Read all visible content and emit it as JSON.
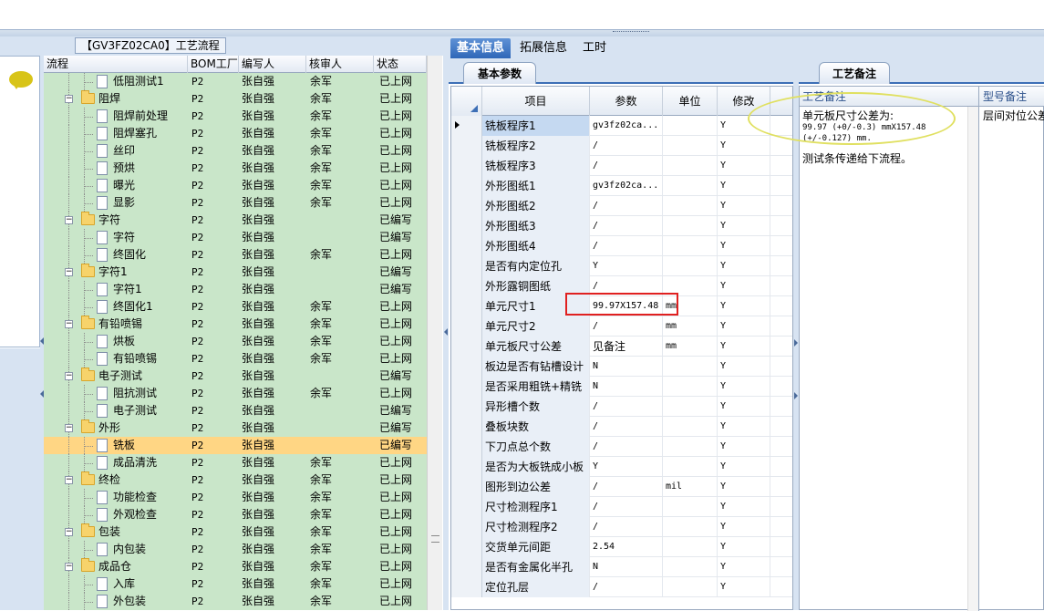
{
  "tree_caption": "【GV3FZ02CA0】工艺流程",
  "tree_columns": [
    "流程",
    "BOM工厂",
    "编写人",
    "核审人",
    "状态"
  ],
  "tree_rows": [
    {
      "name": "低阻测试1",
      "level": 2,
      "icon": "doc-icon",
      "bom": "P2",
      "writer": "张自强",
      "reviewer": "余军",
      "status": "已上网"
    },
    {
      "name": "阻焊",
      "level": 1,
      "icon": "folder-icon",
      "bom": "P2",
      "writer": "张自强",
      "reviewer": "余军",
      "status": "已上网"
    },
    {
      "name": "阻焊前处理",
      "level": 2,
      "icon": "doc-icon",
      "bom": "P2",
      "writer": "张自强",
      "reviewer": "余军",
      "status": "已上网"
    },
    {
      "name": "阻焊塞孔",
      "level": 2,
      "icon": "doc-icon",
      "bom": "P2",
      "writer": "张自强",
      "reviewer": "余军",
      "status": "已上网"
    },
    {
      "name": "丝印",
      "level": 2,
      "icon": "doc-icon",
      "bom": "P2",
      "writer": "张自强",
      "reviewer": "余军",
      "status": "已上网"
    },
    {
      "name": "预烘",
      "level": 2,
      "icon": "doc-icon",
      "bom": "P2",
      "writer": "张自强",
      "reviewer": "余军",
      "status": "已上网"
    },
    {
      "name": "曝光",
      "level": 2,
      "icon": "doc-icon",
      "bom": "P2",
      "writer": "张自强",
      "reviewer": "余军",
      "status": "已上网"
    },
    {
      "name": "显影",
      "level": 2,
      "icon": "doc-icon",
      "bom": "P2",
      "writer": "张自强",
      "reviewer": "余军",
      "status": "已上网"
    },
    {
      "name": "字符",
      "level": 1,
      "icon": "folder-icon",
      "bom": "P2",
      "writer": "张自强",
      "reviewer": "",
      "status": "已编写"
    },
    {
      "name": "字符",
      "level": 2,
      "icon": "doc-icon",
      "bom": "P2",
      "writer": "张自强",
      "reviewer": "",
      "status": "已编写"
    },
    {
      "name": "终固化",
      "level": 2,
      "icon": "doc-icon",
      "bom": "P2",
      "writer": "张自强",
      "reviewer": "余军",
      "status": "已上网"
    },
    {
      "name": "字符1",
      "level": 1,
      "icon": "folder-icon",
      "bom": "P2",
      "writer": "张自强",
      "reviewer": "",
      "status": "已编写"
    },
    {
      "name": "字符1",
      "level": 2,
      "icon": "doc-icon",
      "bom": "P2",
      "writer": "张自强",
      "reviewer": "",
      "status": "已编写"
    },
    {
      "name": "终固化1",
      "level": 2,
      "icon": "doc-icon",
      "bom": "P2",
      "writer": "张自强",
      "reviewer": "余军",
      "status": "已上网"
    },
    {
      "name": "有铅喷锡",
      "level": 1,
      "icon": "folder-icon",
      "bom": "P2",
      "writer": "张自强",
      "reviewer": "余军",
      "status": "已上网"
    },
    {
      "name": "烘板",
      "level": 2,
      "icon": "doc-icon",
      "bom": "P2",
      "writer": "张自强",
      "reviewer": "余军",
      "status": "已上网"
    },
    {
      "name": "有铅喷锡",
      "level": 2,
      "icon": "doc-icon",
      "bom": "P2",
      "writer": "张自强",
      "reviewer": "余军",
      "status": "已上网"
    },
    {
      "name": "电子测试",
      "level": 1,
      "icon": "folder-icon",
      "bom": "P2",
      "writer": "张自强",
      "reviewer": "",
      "status": "已编写"
    },
    {
      "name": "阻抗测试",
      "level": 2,
      "icon": "doc-icon",
      "bom": "P2",
      "writer": "张自强",
      "reviewer": "余军",
      "status": "已上网"
    },
    {
      "name": "电子测试",
      "level": 2,
      "icon": "doc-icon",
      "bom": "P2",
      "writer": "张自强",
      "reviewer": "",
      "status": "已编写"
    },
    {
      "name": "外形",
      "level": 1,
      "icon": "folder-icon",
      "bom": "P2",
      "writer": "张自强",
      "reviewer": "",
      "status": "已编写"
    },
    {
      "name": "铣板",
      "level": 2,
      "icon": "doc-icon",
      "bom": "P2",
      "writer": "张自强",
      "reviewer": "",
      "status": "已编写",
      "selected": true
    },
    {
      "name": "成品清洗",
      "level": 2,
      "icon": "doc-icon",
      "bom": "P2",
      "writer": "张自强",
      "reviewer": "余军",
      "status": "已上网"
    },
    {
      "name": "终检",
      "level": 1,
      "icon": "folder-icon",
      "bom": "P2",
      "writer": "张自强",
      "reviewer": "余军",
      "status": "已上网"
    },
    {
      "name": "功能检查",
      "level": 2,
      "icon": "doc-icon",
      "bom": "P2",
      "writer": "张自强",
      "reviewer": "余军",
      "status": "已上网"
    },
    {
      "name": "外观检查",
      "level": 2,
      "icon": "doc-icon",
      "bom": "P2",
      "writer": "张自强",
      "reviewer": "余军",
      "status": "已上网"
    },
    {
      "name": "包装",
      "level": 1,
      "icon": "folder-icon",
      "bom": "P2",
      "writer": "张自强",
      "reviewer": "余军",
      "status": "已上网"
    },
    {
      "name": "内包装",
      "level": 2,
      "icon": "doc-icon",
      "bom": "P2",
      "writer": "张自强",
      "reviewer": "余军",
      "status": "已上网"
    },
    {
      "name": "成品仓",
      "level": 1,
      "icon": "folder-icon",
      "bom": "P2",
      "writer": "张自强",
      "reviewer": "余军",
      "status": "已上网"
    },
    {
      "name": "入库",
      "level": 2,
      "icon": "doc-icon",
      "bom": "P2",
      "writer": "张自强",
      "reviewer": "余军",
      "status": "已上网"
    },
    {
      "name": "外包装",
      "level": 2,
      "icon": "doc-icon",
      "bom": "P2",
      "writer": "张自强",
      "reviewer": "余军",
      "status": "已上网"
    }
  ],
  "main_tabs": [
    "基本信息",
    "拓展信息",
    "工时"
  ],
  "active_main_tab": 0,
  "sub_tab": "基本参数",
  "param_columns": [
    "项目",
    "参数",
    "单位",
    "修改"
  ],
  "param_rows": [
    {
      "item": "铣板程序1",
      "value": "gv3fz02ca...",
      "unit": "",
      "modify": "Y",
      "current": true
    },
    {
      "item": "铣板程序2",
      "value": "/",
      "unit": "",
      "modify": "Y"
    },
    {
      "item": "铣板程序3",
      "value": "/",
      "unit": "",
      "modify": "Y"
    },
    {
      "item": "外形图纸1",
      "value": "gv3fz02ca...",
      "unit": "",
      "modify": "Y"
    },
    {
      "item": "外形图纸2",
      "value": "/",
      "unit": "",
      "modify": "Y"
    },
    {
      "item": "外形图纸3",
      "value": "/",
      "unit": "",
      "modify": "Y"
    },
    {
      "item": "外形图纸4",
      "value": "/",
      "unit": "",
      "modify": "Y"
    },
    {
      "item": "是否有内定位孔",
      "value": "Y",
      "unit": "",
      "modify": "Y"
    },
    {
      "item": "外形露铜图纸",
      "value": "/",
      "unit": "",
      "modify": "Y"
    },
    {
      "item": "单元尺寸1",
      "value": "99.97X157.48",
      "unit": "mm",
      "modify": "Y"
    },
    {
      "item": "单元尺寸2",
      "value": "/",
      "unit": "mm",
      "modify": "Y"
    },
    {
      "item": "单元板尺寸公差",
      "value": "见备注",
      "unit": "mm",
      "modify": "Y"
    },
    {
      "item": "板边是否有钻槽设计",
      "value": "N",
      "unit": "",
      "modify": "Y"
    },
    {
      "item": "是否采用粗铣+精铣",
      "value": "N",
      "unit": "",
      "modify": "Y"
    },
    {
      "item": "异形槽个数",
      "value": "/",
      "unit": "",
      "modify": "Y"
    },
    {
      "item": "叠板块数",
      "value": "/",
      "unit": "",
      "modify": "Y"
    },
    {
      "item": "下刀点总个数",
      "value": "/",
      "unit": "",
      "modify": "Y"
    },
    {
      "item": "是否为大板铣成小板",
      "value": "Y",
      "unit": "",
      "modify": "Y"
    },
    {
      "item": "图形到边公差",
      "value": "/",
      "unit": "mil",
      "modify": "Y"
    },
    {
      "item": "尺寸检测程序1",
      "value": "/",
      "unit": "",
      "modify": "Y"
    },
    {
      "item": "尺寸检测程序2",
      "value": "/",
      "unit": "",
      "modify": "Y"
    },
    {
      "item": "交货单元间距",
      "value": "2.54",
      "unit": "",
      "modify": "Y"
    },
    {
      "item": "是否有金属化半孔",
      "value": "N",
      "unit": "",
      "modify": "Y"
    },
    {
      "item": "定位孔层",
      "value": "/",
      "unit": "",
      "modify": "Y"
    }
  ],
  "right_tab": "工艺备注",
  "right_columns": [
    "工艺备注",
    "型号备注"
  ],
  "remark_lines": [
    "单元板尺寸公差为:",
    "99.97 (+0/-0.3) mmX157.48",
    " (+/-0.127) mm.",
    "测试条传递给下流程。"
  ],
  "model_remark": "层间对位公差",
  "colors": {
    "tree_bg": "#c9e6c9",
    "selected_row": "#ffd684",
    "tab_active": "#2f67b8",
    "highlight_box": "#e02020",
    "ellipse": "#e0e060"
  }
}
